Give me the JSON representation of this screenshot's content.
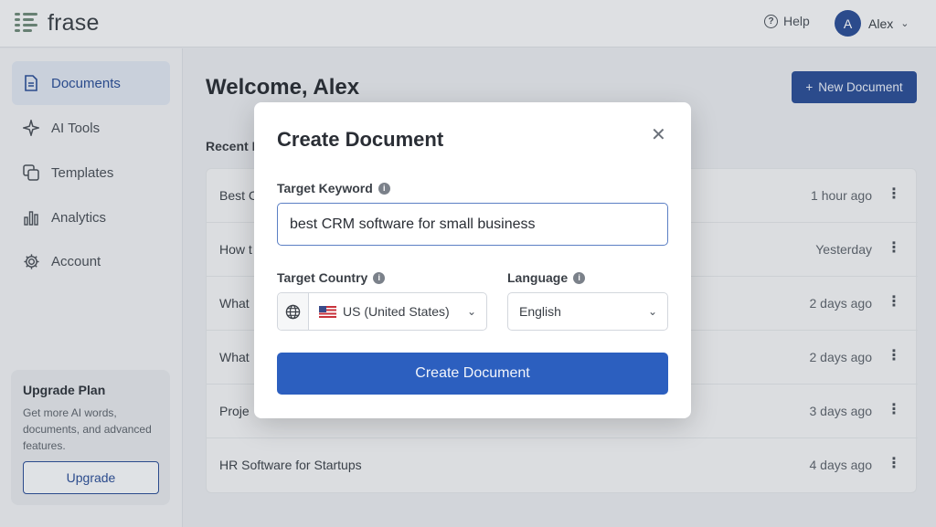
{
  "app": {
    "logo_text": "frase"
  },
  "topbar": {
    "help_label": "Help",
    "user_initial": "A",
    "user_name": "Alex"
  },
  "sidebar": {
    "items": [
      {
        "label": "Documents",
        "icon": "document-icon"
      },
      {
        "label": "AI Tools",
        "icon": "sparkle-icon"
      },
      {
        "label": "Templates",
        "icon": "templates-icon"
      },
      {
        "label": "Analytics",
        "icon": "bar-chart-icon"
      },
      {
        "label": "Account",
        "icon": "gear-icon"
      }
    ],
    "upgrade": {
      "title": "Upgrade Plan",
      "description": "Get more AI words, documents, and advanced features.",
      "button_label": "Upgrade"
    }
  },
  "main": {
    "welcome": "Welcome, Alex",
    "new_document_label": "New Document",
    "recent_heading": "Recent D",
    "documents": [
      {
        "title": "Best C",
        "time": "1 hour ago"
      },
      {
        "title": "How t",
        "time": "Yesterday"
      },
      {
        "title": "What",
        "time": "2 days ago"
      },
      {
        "title": "What",
        "time": "2 days ago"
      },
      {
        "title": "Proje",
        "time": "3 days ago"
      },
      {
        "title": "HR Software for Startups",
        "time": "4 days ago"
      }
    ]
  },
  "modal": {
    "title": "Create Document",
    "keyword_label": "Target Keyword",
    "keyword_value": "best CRM software for small business",
    "country_label": "Target Country",
    "country_value": "US (United States)",
    "language_label": "Language",
    "language_value": "English",
    "submit_label": "Create Document"
  },
  "colors": {
    "brand": "#2c4f96",
    "primary_button": "#2c5fbf",
    "focus_border": "#5b7fc4"
  }
}
